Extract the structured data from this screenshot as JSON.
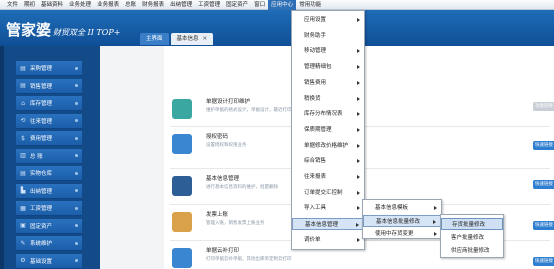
{
  "menubar": {
    "items": [
      "文件",
      "期初",
      "基础资料",
      "业务处理",
      "业务报表",
      "总账",
      "财务报表",
      "出纳管理",
      "工资管理",
      "固定资产",
      "窗口",
      "应用中心",
      "常用功能"
    ],
    "active_index": 11
  },
  "header": {
    "logo_main": "管家婆",
    "logo_sub": "财贸双全 II TOP+"
  },
  "tabs": {
    "home": "主界面",
    "current": "基本信息",
    "close": "✕"
  },
  "sidebar": {
    "items": [
      {
        "icon": "▤",
        "label": "采购管理"
      },
      {
        "icon": "▤",
        "label": "销售管理"
      },
      {
        "icon": "⌂",
        "label": "库存管理"
      },
      {
        "icon": "⟲",
        "label": "往来管理"
      },
      {
        "icon": "$",
        "label": "费用管理"
      },
      {
        "icon": "▥",
        "label": "总  账"
      },
      {
        "icon": "▤",
        "label": "实物仓库"
      },
      {
        "icon": "▙",
        "label": "出纳管理"
      },
      {
        "icon": "▦",
        "label": "工资管理"
      },
      {
        "icon": "▣",
        "label": "固定资产"
      },
      {
        "icon": "✎",
        "label": "系统维护"
      },
      {
        "icon": "⚙",
        "label": "基础设置"
      }
    ]
  },
  "cards": [
    {
      "title": "单据设计打印维护",
      "desc": "维护单据的格式设计，单据设计，最近打印设置",
      "color": "#3aa7a0",
      "icon": "paintbrush-icon"
    },
    {
      "title": "授权密码",
      "desc": "设置授权和权限业务",
      "color": "#3a86d0",
      "icon": "password-icon"
    },
    {
      "title": "基本信息管理",
      "desc": "进行基本信息资料的维护，批量删除",
      "color": "#2d5f96",
      "icon": "info-icon"
    },
    {
      "title": "发票上账",
      "desc": "管理入账，销售发票上账业务",
      "color": "#d9a24a",
      "icon": "invoice-icon"
    },
    {
      "title": "单据云补打印",
      "desc": "打印单据云补单据，其他出库单定制云打印",
      "color": "#3a86d0",
      "icon": "cloud-print-icon"
    }
  ],
  "quick_buttons": [
    "功能链接",
    "快速链接",
    "快速链接",
    "快速链接",
    "快速链接"
  ],
  "menu1": {
    "items": [
      {
        "label": "应用设置",
        "arrow": true
      },
      {
        "label": "财务助手",
        "arrow": false
      },
      {
        "label": "移动管理",
        "arrow": true
      },
      {
        "label": "管理精细包",
        "arrow": true
      },
      {
        "label": "销售费用",
        "arrow": true
      },
      {
        "label": "稍换货",
        "arrow": true
      },
      {
        "label": "库存分布情况表",
        "arrow": true
      },
      {
        "label": "保质期管理",
        "arrow": true
      },
      {
        "label": "单据修改价格维护",
        "arrow": true
      },
      {
        "label": "综合销售",
        "arrow": true
      },
      {
        "label": "往来报表",
        "arrow": true
      },
      {
        "label": "订单提交汇控制",
        "arrow": true
      },
      {
        "label": "导入工具",
        "arrow": true
      },
      {
        "label": "基本信息管理",
        "arrow": true
      },
      {
        "label": "调价单",
        "arrow": true
      }
    ],
    "selected_index": 13
  },
  "menu2": {
    "items": [
      {
        "label": "基本信息模板",
        "arrow": true
      },
      {
        "label": "基本信息批量修改",
        "arrow": true
      },
      {
        "label": "使用中存货变更",
        "arrow": true
      }
    ],
    "selected_index": 1
  },
  "menu3": {
    "items": [
      {
        "label": "存货批量修改"
      },
      {
        "label": "客户批量修改"
      },
      {
        "label": "供应商批量修改"
      }
    ],
    "active_index": 0
  }
}
